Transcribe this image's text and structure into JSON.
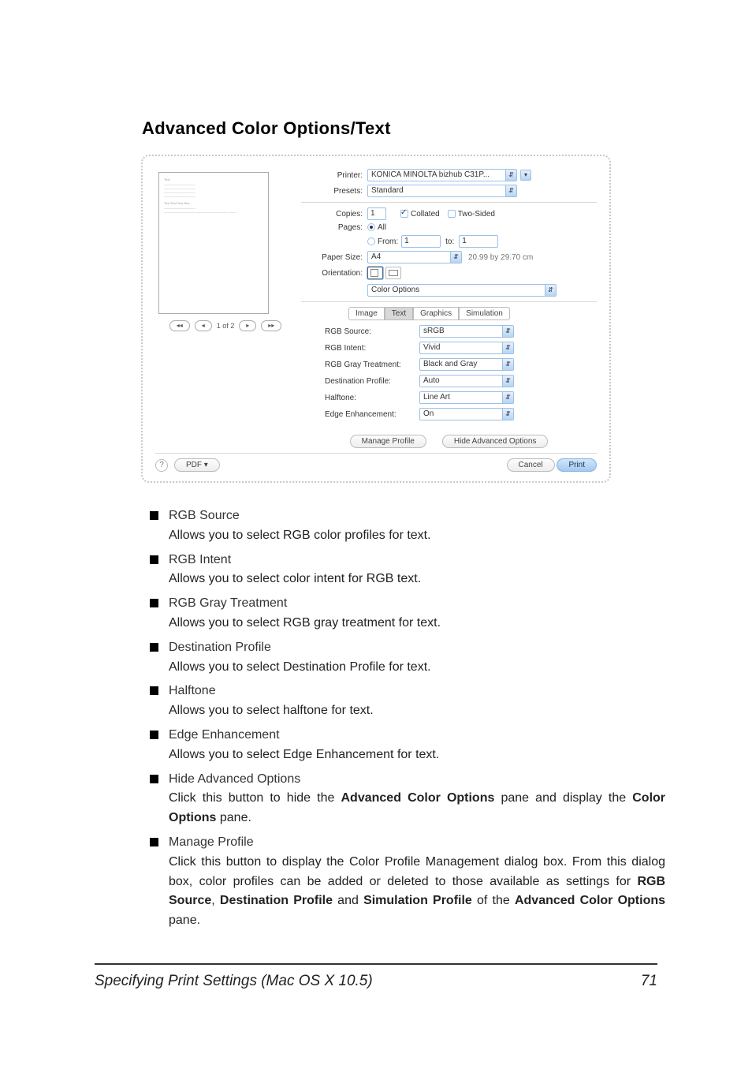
{
  "page_heading": "Advanced Color Options/Text",
  "dialog": {
    "printer_label": "Printer:",
    "printer_value": "KONICA MINOLTA bizhub C31P...",
    "presets_label": "Presets:",
    "presets_value": "Standard",
    "copies_label": "Copies:",
    "copies_value": "1",
    "collated_label": "Collated",
    "two_sided_label": "Two-Sided",
    "pages_label": "Pages:",
    "pages_all_label": "All",
    "pages_from_label": "From:",
    "pages_from_value": "1",
    "pages_to_label": "to:",
    "pages_to_value": "1",
    "paper_label": "Paper Size:",
    "paper_value": "A4",
    "paper_dim": "20.99 by 29.70 cm",
    "orientation_label": "Orientation:",
    "section_select": "Color Options",
    "tabs": [
      "Image",
      "Text",
      "Graphics",
      "Simulation"
    ],
    "active_tab": "Text",
    "opts": [
      {
        "label": "RGB Source:",
        "value": "sRGB"
      },
      {
        "label": "RGB Intent:",
        "value": "Vivid"
      },
      {
        "label": "RGB Gray Treatment:",
        "value": "Black and Gray"
      },
      {
        "label": "Destination Profile:",
        "value": "Auto"
      },
      {
        "label": "Halftone:",
        "value": "Line Art"
      },
      {
        "label": "Edge Enhancement:",
        "value": "On"
      }
    ],
    "manage_profile_btn": "Manage Profile",
    "hide_adv_btn": "Hide Advanced Options",
    "pdf_btn": "PDF ▾",
    "cancel_btn": "Cancel",
    "print_btn": "Print",
    "pager": "1 of 2"
  },
  "items": [
    {
      "title": "RGB Source",
      "desc": "Allows you to select RGB color profiles for text."
    },
    {
      "title": "RGB Intent",
      "desc": "Allows you to select color intent for RGB text."
    },
    {
      "title": "RGB Gray Treatment",
      "desc": "Allows you to select RGB gray treatment for text."
    },
    {
      "title": "Destination Profile",
      "desc": "Allows you to select Destination Profile for text."
    },
    {
      "title": "Halftone",
      "desc": "Allows you to select halftone for text."
    },
    {
      "title": "Edge Enhancement",
      "desc": "Allows you to select Edge Enhancement for text."
    },
    {
      "title": "Hide Advanced Options",
      "desc_html": "Click this button to hide the <b>Advanced Color Options</b> pane and display the <b>Color Options</b> pane."
    },
    {
      "title": "Manage Profile",
      "desc_html": "Click this button to display the Color Profile Management dialog box. From this dialog box, color profiles can be added or deleted to those available as settings for <b>RGB Source</b>, <b>Destination Profile</b> and <b>Simulation Profile</b> of the <b>Advanced Color Options</b> pane."
    }
  ],
  "footer": {
    "left": "Specifying Print Settings (Mac OS X 10.5)",
    "right": "71"
  }
}
